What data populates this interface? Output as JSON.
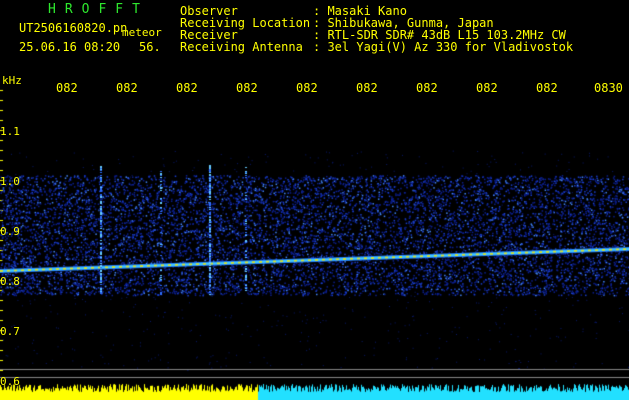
{
  "header": {
    "program": "HROFFT",
    "filename": "UT2506160820.pn",
    "tag": "meteor",
    "datetime": "25.06.16 08:20",
    "count": "56.",
    "rows": [
      {
        "label": "Observer",
        "value": ": Masaki Kano"
      },
      {
        "label": "Receiving Location",
        "value": ": Shibukawa, Gunma, Japan"
      },
      {
        "label": "Receiver",
        "value": ": RTL-SDR SDR# 43dB L15 103.2MHz CW"
      },
      {
        "label": "Receiving Antenna",
        "value": ": 3el Yagi(V) Az 330 for Vladivostok"
      }
    ]
  },
  "axes": {
    "y_unit": "kHz",
    "y_ticks": [
      "1.1",
      "1.0",
      "0.9",
      "0.8",
      "0.7",
      "0.6"
    ],
    "x_ticks": [
      "082",
      "082",
      "082",
      "082",
      "082",
      "082",
      "082",
      "082",
      "082",
      "0830"
    ]
  },
  "colors": {
    "text": "#ffff00",
    "program": "#2ee82e",
    "background": "#000000",
    "trace": "#2299ff",
    "band": "#0a1a7a"
  }
}
